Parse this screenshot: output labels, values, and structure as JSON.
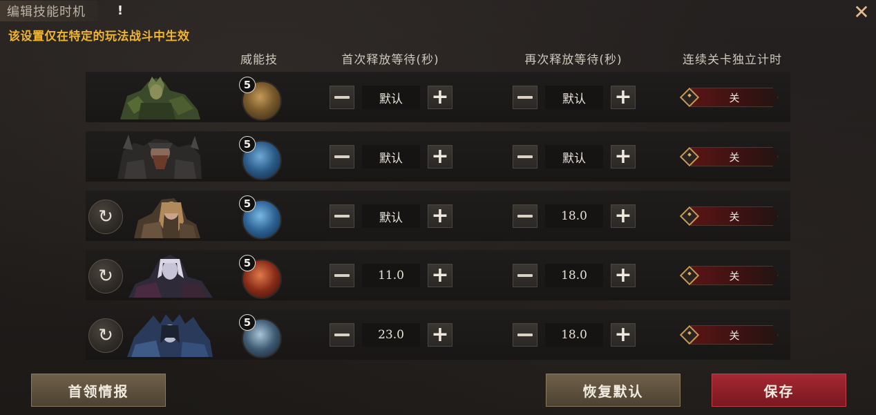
{
  "title": "编辑技能时机",
  "warning_glyph": "!",
  "close_glyph": "✕",
  "notice": "该设置仅在特定的玩法战斗中生效",
  "headers": {
    "skill": "威能技",
    "first_wait": "首次释放等待(秒)",
    "repeat_wait": "再次释放等待(秒)",
    "independent_timer": "连续关卡独立计时"
  },
  "rows": [
    {
      "has_reset": false,
      "skill_level": "5",
      "skill_icon": "golden-hero-emblem-icon",
      "first_wait": "默认",
      "repeat_wait": "默认",
      "toggle": "关"
    },
    {
      "has_reset": false,
      "skill_level": "5",
      "skill_icon": "ice-shards-icon",
      "first_wait": "默认",
      "repeat_wait": "默认",
      "toggle": "关"
    },
    {
      "has_reset": true,
      "skill_level": "5",
      "skill_icon": "lightning-claw-icon",
      "first_wait": "默认",
      "repeat_wait": "18.0",
      "toggle": "关"
    },
    {
      "has_reset": true,
      "skill_level": "5",
      "skill_icon": "fire-scorpion-icon",
      "first_wait": "11.0",
      "repeat_wait": "18.0",
      "toggle": "关"
    },
    {
      "has_reset": true,
      "skill_level": "5",
      "skill_icon": "frost-wyrm-icon",
      "first_wait": "23.0",
      "repeat_wait": "18.0",
      "toggle": "关"
    }
  ],
  "buttons": {
    "boss_info": "首领情报",
    "restore_default": "恢复默认",
    "save": "保存"
  },
  "colors": {
    "notice": "#f0b530",
    "toggle_off": "#5a1515",
    "save_button": "#a52833",
    "neutral_button": "#6f6049"
  }
}
